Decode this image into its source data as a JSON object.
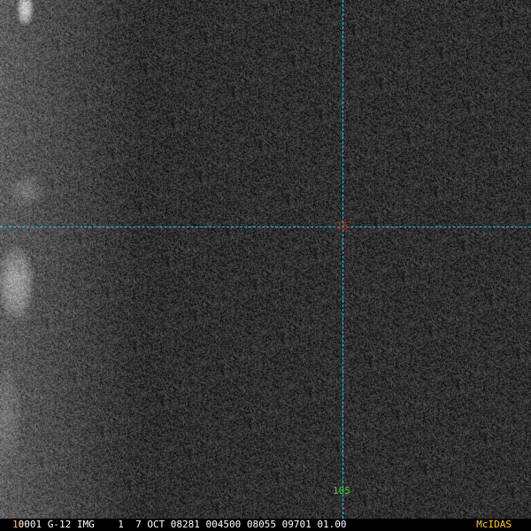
{
  "colors": {
    "gridline": "#22c8c8",
    "lat_label": "#cc2222",
    "lon_label": "#22dd22",
    "frame_number": "#ffd200",
    "status_text": "#ffffff",
    "brand": "#ffd200"
  },
  "overlay": {
    "lat_label": "15",
    "lon_label": "105"
  },
  "status_bar": {
    "frame_number": "1",
    "text": "0001 G-12 IMG    1  7 OCT 08281 004500 08055 09701 01.00",
    "brand": "McIDAS"
  }
}
